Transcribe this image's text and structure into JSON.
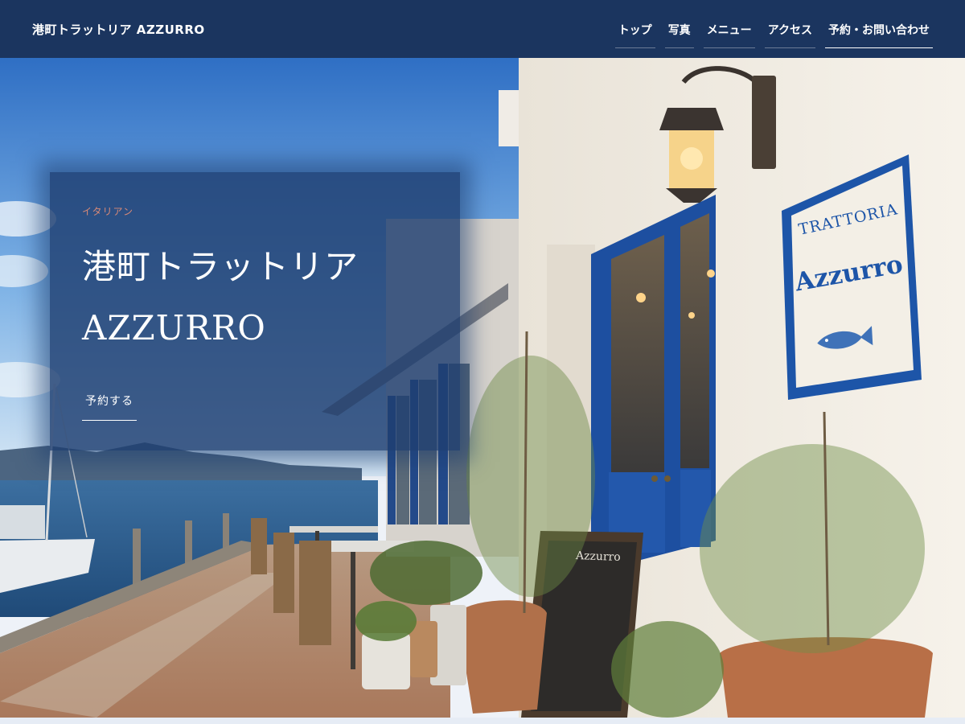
{
  "header": {
    "site_title": "港町トラットリア AZZURRO",
    "nav": [
      {
        "label": "トップ"
      },
      {
        "label": "写真"
      },
      {
        "label": "メニュー"
      },
      {
        "label": "アクセス"
      },
      {
        "label": "予約・お問い合わせ"
      }
    ]
  },
  "hero": {
    "category": "イタリアン",
    "title": "港町トラットリア AZZURRO",
    "cta_label": "予約する",
    "sign_line1": "TRATTORIA",
    "sign_line2": "Azzurro",
    "chalkboard_title": "Azzurro"
  },
  "colors": {
    "header_bg": "#1b355f",
    "card_bg": "#1e3e70",
    "category_accent": "#d98a76",
    "door_blue": "#1d4fa0"
  },
  "icons": {
    "fish": "fish-icon"
  }
}
